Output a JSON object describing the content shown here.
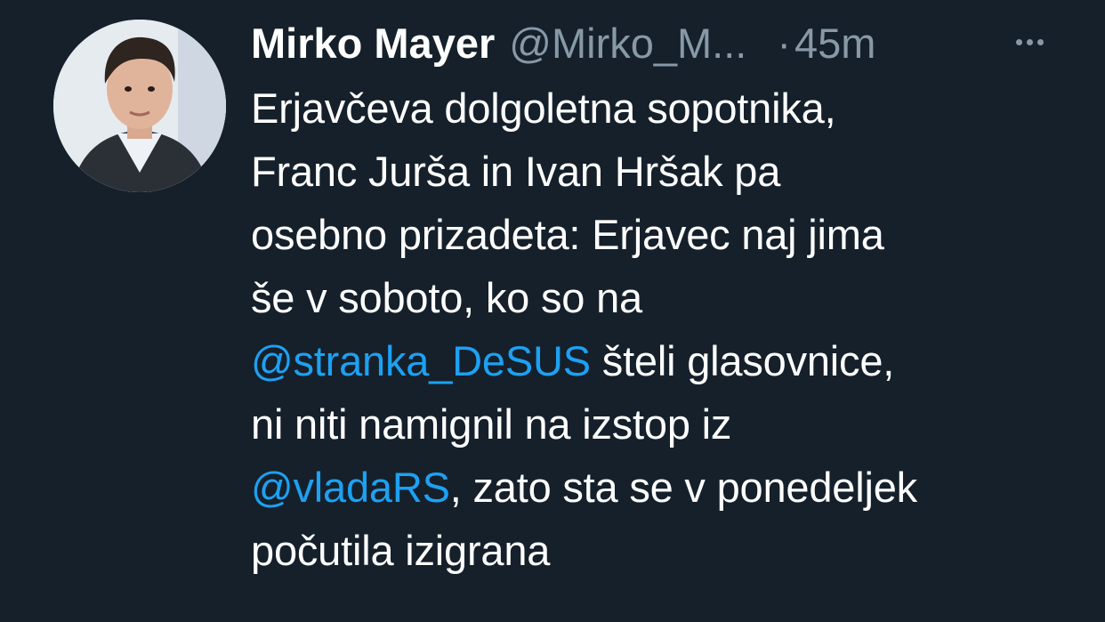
{
  "author": {
    "name": "Mirko Mayer",
    "handle": "@Mirko_M...",
    "separator": "·",
    "time": "45m"
  },
  "tweet": {
    "line1": "Erjavčeva dolgoletna sopotnika,",
    "line2": "Franc Jurša in Ivan Hršak pa",
    "line3": "osebno prizadeta: Erjavec naj jima",
    "line4": "še v soboto, ko so na",
    "mention1": "@stranka_DeSUS",
    "line5_after": " šteli glasovnice,",
    "line6": "ni niti namignil na izstop iz",
    "mention2": "@vladaRS",
    "line7_after": ", zato sta se v ponedeljek",
    "line8": "počutila izigrana"
  },
  "icons": {
    "avatar": "avatar-photo",
    "more": "more-options-icon"
  },
  "colors": {
    "background": "#15202b",
    "text": "#ffffff",
    "muted": "#8899a6",
    "link": "#1da1f2"
  }
}
